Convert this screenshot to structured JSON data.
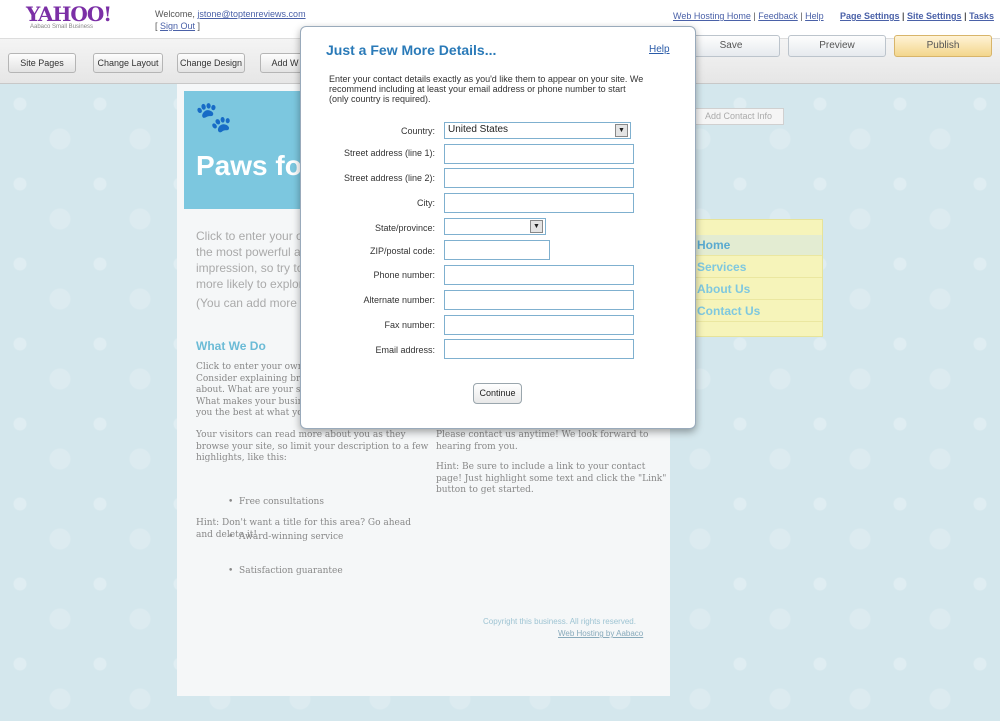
{
  "header": {
    "logo": "YAHOO!",
    "logo_sub": "Aabaco Small Business",
    "welcome_prefix": "Welcome,",
    "user_email": "jstone@toptenreviews.com",
    "sign_out": "Sign Out",
    "links_left": [
      "Web Hosting Home",
      "Feedback",
      "Help"
    ],
    "links_right": [
      "Page Settings",
      "Site Settings",
      "Tasks"
    ]
  },
  "toolbar": {
    "site_pages": "Site Pages",
    "change_layout": "Change Layout",
    "change_design": "Change Design",
    "add_widget": "Add W",
    "save": "Save",
    "preview": "Preview",
    "publish": "Publish"
  },
  "page": {
    "hero_title": "Paws fo",
    "intro": "Click to enter your o\nthe most powerful a\nimpression, so try to\nmore likely to explor",
    "intro_note": "(You can add more t",
    "what_we_do_title": "What We Do",
    "what_we_do_body": "Click to enter your own c\nConsider explaining bri\nabout. What are your str\nWhat makes your busine\nyou the best at what you",
    "visitors_text": "Your visitors can read more about you as they\nbrowse your site, so limit your description to a few\nhighlights, like this:",
    "bullets": [
      "Free consultations",
      "Award-winning service",
      "Satisfaction guarantee"
    ],
    "hint1": "Hint: Don't want a title for this area? Go ahead\nand delete it!",
    "contact_text": "Please contact us anytime! We look forward to\nhearing from you.",
    "hint2": "Hint: Be sure to include a link to your contact\npage! Just highlight some text and click the \"Link\"\nbutton to get started.",
    "copyright": "Copyright this business. All rights reserved.",
    "web_hosting": "Web Hosting by Aabaco"
  },
  "sidebar": {
    "add_contact": "Add Contact Info",
    "nav": [
      "Home",
      "Services",
      "About Us",
      "Contact Us"
    ]
  },
  "modal": {
    "title": "Just a Few More Details...",
    "help": "Help",
    "description": "Enter your contact details exactly as you'd like them to appear on your site. We\nrecommend including at least your email address or phone number to start\n(only country is required).",
    "fields": {
      "country_label": "Country:",
      "country_value": "United States",
      "street1_label": "Street address (line 1):",
      "street2_label": "Street address (line 2):",
      "city_label": "City:",
      "state_label": "State/province:",
      "zip_label": "ZIP/postal code:",
      "phone_label": "Phone number:",
      "alt_label": "Alternate number:",
      "fax_label": "Fax number:",
      "email_label": "Email address:"
    },
    "continue": "Continue"
  }
}
